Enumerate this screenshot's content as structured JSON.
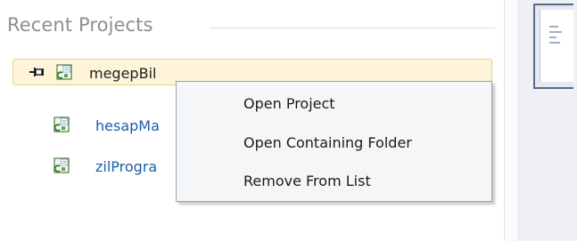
{
  "section": {
    "title": "Recent Projects"
  },
  "recent_projects": [
    {
      "label": "megepBil",
      "pinned": true
    },
    {
      "label": "hesapMa",
      "pinned": false
    },
    {
      "label": "zilProgra",
      "pinned": false
    }
  ],
  "context_menu": {
    "items": [
      "Open Project",
      "Open Containing Folder",
      "Remove From List"
    ]
  },
  "icons": {
    "pin": "pin-icon",
    "project": "csharp-project-icon"
  },
  "colors": {
    "link": "#1a5ea8",
    "pinned_background": "#fdf4d9",
    "pinned_border": "#e8cf86",
    "menu_background": "#f5f6f8"
  }
}
